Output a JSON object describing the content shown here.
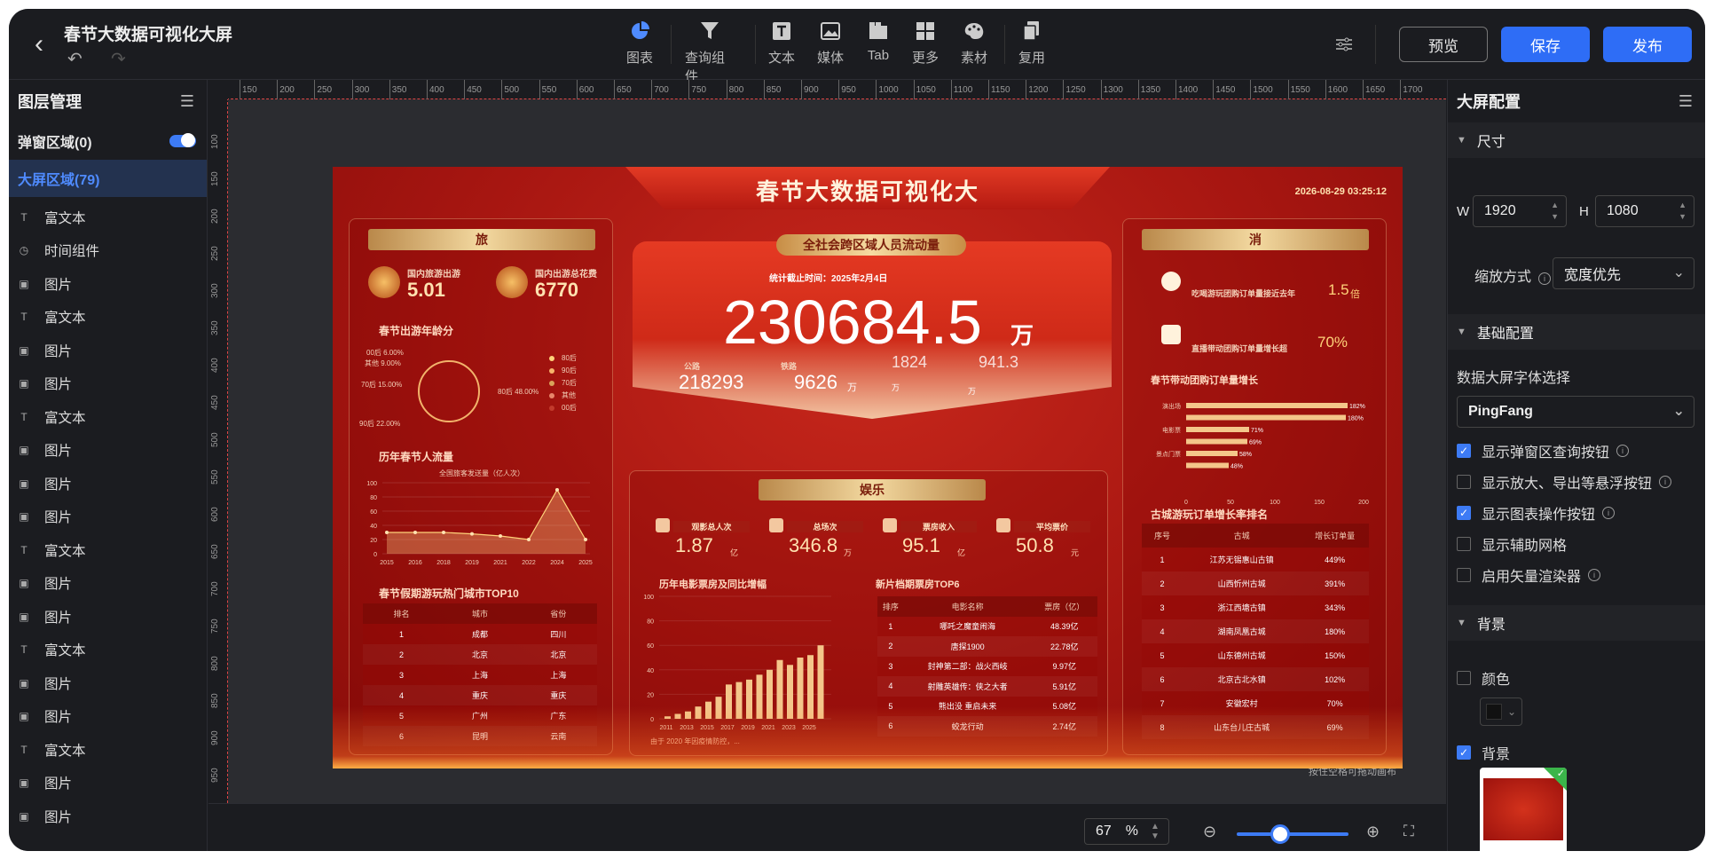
{
  "header": {
    "title": "春节大数据可视化大屏",
    "tools": [
      {
        "label": "图表",
        "icon": "pie-chart-icon"
      },
      {
        "label": "查询组件",
        "icon": "filter-icon"
      },
      {
        "label": "文本",
        "icon": "text-icon"
      },
      {
        "label": "媒体",
        "icon": "image-icon"
      },
      {
        "label": "Tab",
        "icon": "tab-icon"
      },
      {
        "label": "更多",
        "icon": "grid-icon"
      },
      {
        "label": "素材",
        "icon": "palette-icon"
      },
      {
        "label": "复用",
        "icon": "copy-icon"
      }
    ],
    "preview_label": "预览",
    "save_label": "保存",
    "publish_label": "发布"
  },
  "layers": {
    "title": "图层管理",
    "popup_area": "弹窗区域(0)",
    "screen_area": "大屏区域(79)",
    "items": [
      {
        "label": "富文本",
        "type": "text"
      },
      {
        "label": "时间组件",
        "type": "clock"
      },
      {
        "label": "图片",
        "type": "image"
      },
      {
        "label": "富文本",
        "type": "text"
      },
      {
        "label": "图片",
        "type": "image"
      },
      {
        "label": "图片",
        "type": "image"
      },
      {
        "label": "富文本",
        "type": "text"
      },
      {
        "label": "图片",
        "type": "image"
      },
      {
        "label": "图片",
        "type": "image"
      },
      {
        "label": "图片",
        "type": "image"
      },
      {
        "label": "富文本",
        "type": "text"
      },
      {
        "label": "图片",
        "type": "image"
      },
      {
        "label": "图片",
        "type": "image"
      },
      {
        "label": "富文本",
        "type": "text"
      },
      {
        "label": "图片",
        "type": "image"
      },
      {
        "label": "图片",
        "type": "image"
      },
      {
        "label": "富文本",
        "type": "text"
      },
      {
        "label": "图片",
        "type": "image"
      },
      {
        "label": "图片",
        "type": "image"
      }
    ]
  },
  "ruler": {
    "h_ticks": [
      "150",
      "200",
      "250",
      "300",
      "350",
      "400",
      "450",
      "500",
      "550",
      "600",
      "650",
      "700",
      "750",
      "800",
      "850",
      "900",
      "950",
      "1000",
      "1050",
      "1100",
      "1150",
      "1200",
      "1250",
      "1300",
      "1350",
      "1400",
      "1450",
      "1500",
      "1550",
      "1600",
      "1650",
      "1700"
    ],
    "v_ticks": [
      "100",
      "150",
      "200",
      "250",
      "300",
      "350",
      "400",
      "450",
      "500",
      "550",
      "600",
      "650",
      "700",
      "750",
      "800",
      "850",
      "900",
      "950"
    ]
  },
  "canvas": {
    "hint": "按住空格可拖动画布",
    "zoom": "67",
    "zoom_unit": "%"
  },
  "screen": {
    "title": "春节大数据可视化大",
    "datetime": "2026-08-29 03:25:12",
    "left_title": "旅",
    "left_kpi1_label": "国内旅游出游",
    "left_kpi1_value": "5.01",
    "left_kpi2_label": "国内出游总花费",
    "left_kpi2_value": "6770",
    "age_title": "春节出游年龄分",
    "age_labels": [
      "00后 6.00%",
      "其他 9.00%",
      "70后 15.00%",
      "90后 22.00%",
      "80后 48.00%"
    ],
    "age_legend": [
      "80后",
      "90后",
      "70后",
      "其他",
      "00后"
    ],
    "flow_title": "历年春节人流量",
    "flow_legend": "全国旅客发送量（亿人次）",
    "flow_chart": {
      "x": [
        "2015",
        "2016",
        "2018",
        "2019",
        "2021",
        "2022",
        "2024",
        "2025"
      ],
      "y": [
        30,
        30,
        30,
        28,
        25,
        20,
        90,
        20
      ],
      "yticks": [
        "100",
        "80",
        "60",
        "40",
        "20",
        "0"
      ]
    },
    "city_title": "春节假期游玩热门城市TOP10",
    "city_headers": [
      "排名",
      "城市",
      "省份"
    ],
    "city_rows": [
      [
        "1",
        "成都",
        "四川"
      ],
      [
        "2",
        "北京",
        "北京"
      ],
      [
        "3",
        "上海",
        "上海"
      ],
      [
        "4",
        "重庆",
        "重庆"
      ],
      [
        "5",
        "广州",
        "广东"
      ],
      [
        "6",
        "昆明",
        "云南"
      ]
    ],
    "center_title": "全社会跨区域人员流动量",
    "center_time": "统计截止时间：2025年2月4日",
    "center_value": "230684.5",
    "center_unit": "万",
    "road_label": "公路",
    "road_value": "218293",
    "rail_label": "铁路",
    "rail_value": "9626",
    "rail_unit": "万",
    "ghost1": "1824",
    "ghost2": "941.3",
    "ghost_unit1": "万",
    "ghost_unit2": "万",
    "ent_title": "娱乐",
    "ent_kpis": [
      {
        "label": "观影总人次",
        "value": "1.87",
        "unit": "亿"
      },
      {
        "label": "总场次",
        "value": "346.8",
        "unit": "万"
      },
      {
        "label": "票房收入",
        "value": "95.1",
        "unit": "亿"
      },
      {
        "label": "平均票价",
        "value": "50.8",
        "unit": "元"
      }
    ],
    "movie_bar_title": "历年电影票房及同比增幅",
    "movie_bar_note": "由于 2020 年因疫情防控，...",
    "movie_bars": {
      "x": [
        "2011",
        "2013",
        "2015",
        "2017",
        "2019",
        "2021",
        "2023",
        "2025"
      ],
      "y": [
        2,
        4,
        6,
        10,
        14,
        18,
        28,
        30,
        32,
        36,
        40,
        48,
        44,
        50,
        52,
        60
      ],
      "yticks": [
        "100",
        "80",
        "60",
        "40",
        "20",
        "0"
      ]
    },
    "top6_title": "新片档期票房TOP6",
    "top6_headers": [
      "排序",
      "电影名称",
      "票房（亿）"
    ],
    "top6_rows": [
      [
        "1",
        "哪吒之魔童闹海",
        "48.39亿"
      ],
      [
        "2",
        "唐探1900",
        "22.78亿"
      ],
      [
        "3",
        "封神第二部：战火西岐",
        "9.97亿"
      ],
      [
        "4",
        "射雕英雄传：侠之大者",
        "5.91亿"
      ],
      [
        "5",
        "熊出没 重启未来",
        "5.08亿"
      ],
      [
        "6",
        "蛟龙行动",
        "2.74亿"
      ]
    ],
    "right_title": "消",
    "right_kpi1_label": "吃喝游玩团购订单量接近去年",
    "right_kpi1_value": "1.5",
    "right_kpi1_unit": "倍",
    "right_kpi2_label": "直播带动团购订单量增长超",
    "right_kpi2_value": "70%",
    "hbar_title": "春节带动团购订单量增长",
    "hbars": [
      {
        "name": "演出场",
        "value": 182
      },
      {
        "name": "",
        "value": 180
      },
      {
        "name": "电影票",
        "value": 71
      },
      {
        "name": "",
        "value": 69
      },
      {
        "name": "景点门票",
        "value": 58
      },
      {
        "name": "",
        "value": 48
      }
    ],
    "hbar_ticks": [
      "0",
      "50",
      "100",
      "150",
      "200"
    ],
    "town_title": "古城游玩订单增长率排名",
    "town_headers": [
      "序号",
      "古城",
      "增长订单量"
    ],
    "town_rows": [
      [
        "1",
        "江苏无锡惠山古镇",
        "449%"
      ],
      [
        "2",
        "山西忻州古城",
        "391%"
      ],
      [
        "3",
        "浙江西塘古镇",
        "343%"
      ],
      [
        "4",
        "湖南凤凰古城",
        "180%"
      ],
      [
        "5",
        "山东德州古城",
        "150%"
      ],
      [
        "6",
        "北京古北水镇",
        "102%"
      ],
      [
        "7",
        "安徽宏村",
        "70%"
      ],
      [
        "8",
        "山东台儿庄古城",
        "69%"
      ]
    ]
  },
  "right_panel": {
    "title": "大屏配置",
    "size_title": "尺寸",
    "w_label": "W",
    "w_value": "1920",
    "h_label": "H",
    "h_value": "1080",
    "scale_label": "缩放方式",
    "scale_value": "宽度优先",
    "basic_title": "基础配置",
    "font_label": "数据大屏字体选择",
    "font_value": "PingFang",
    "options": [
      {
        "label": "显示弹窗区查询按钮",
        "checked": true
      },
      {
        "label": "显示放大、导出等悬浮按钮",
        "checked": false
      },
      {
        "label": "显示图表操作按钮",
        "checked": true
      },
      {
        "label": "显示辅助网格",
        "checked": false
      },
      {
        "label": "启用矢量渲染器",
        "checked": false
      }
    ],
    "bg_title": "背景",
    "color_label": "颜色",
    "bg_label": "背景"
  },
  "colors": {
    "accent": "#3d7bf5",
    "screen_red": "#b71c14",
    "gold": "#f3d9a0"
  }
}
